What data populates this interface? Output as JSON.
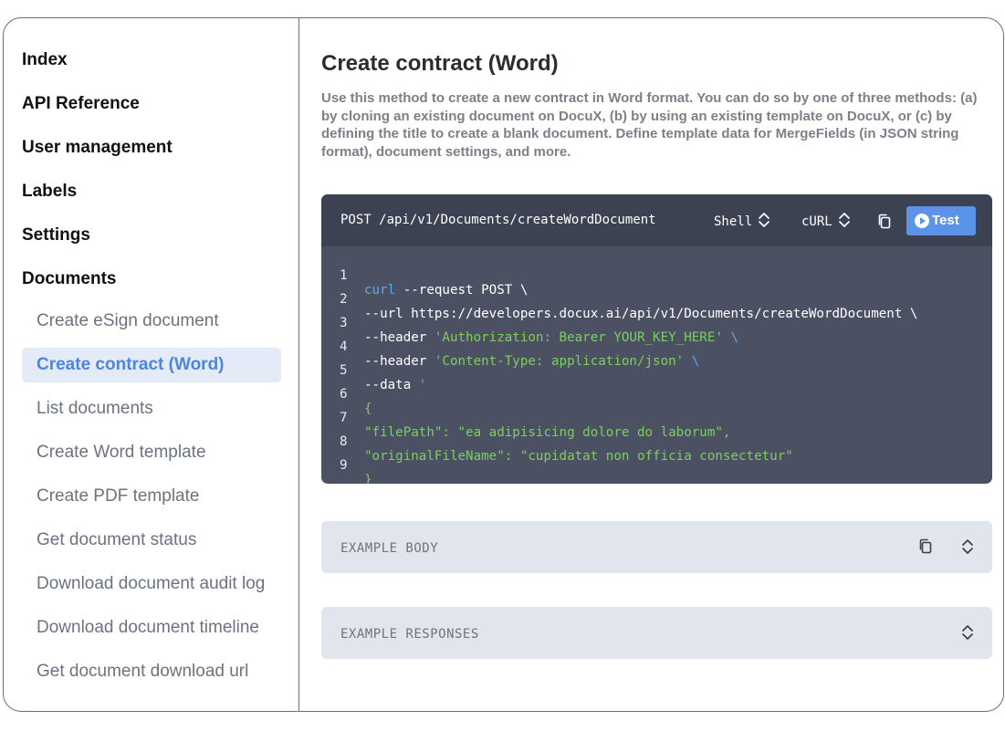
{
  "sidebar": {
    "sections": {
      "index": "Index",
      "api_reference": "API Reference",
      "user_management": "User management",
      "labels": "Labels",
      "settings": "Settings",
      "documents": "Documents"
    },
    "documents_items": [
      "Create eSign document",
      "Create contract (Word)",
      "List documents",
      "Create Word template",
      "Create PDF template",
      "Get document status",
      "Download document audit log",
      "Download document timeline",
      "Get document download url"
    ],
    "active_item": "Create contract (Word)"
  },
  "main": {
    "title": "Create contract (Word)",
    "description": "Use this method to create a new contract in Word format. You can do so by one of three methods: (a) by cloning an existing document on DocuX, (b) by using an existing template on DocuX, or (c) by defining the title to create a blank document. Define template data for MergeFields (in JSON string format), document settings, and more."
  },
  "code": {
    "endpoint": "POST /api/v1/Documents/createWordDocument",
    "language_select": "Shell",
    "client_select": "cURL",
    "test_label": "Test",
    "line_numbers": [
      "1",
      "2",
      "3",
      "4",
      "5",
      "6",
      "7",
      "8",
      "9"
    ],
    "lines": [
      {
        "a": "curl",
        "b": " --request POST \\"
      },
      {
        "a": "--url https://developers.docux.ai/api/v1/Documents/createWordDocument \\"
      },
      {
        "a": "--header ",
        "b": "'Authorization: Bearer YOUR_KEY_HERE'",
        "c": " \\"
      },
      {
        "a": "--header ",
        "b": "'Content-Type: application/json'",
        "c": " \\"
      },
      {
        "a": "--data ",
        "b": "'"
      },
      {
        "a": "{"
      },
      {
        "a": "\"filePath\": \"ea adipisicing dolore do laborum\","
      },
      {
        "a": "\"originalFileName\": \"cupidatat non officia consectetur\""
      },
      {
        "a": "}"
      }
    ]
  },
  "accordions": {
    "example_body": "EXAMPLE BODY",
    "example_responses": "EXAMPLE RESPONSES"
  },
  "colors": {
    "accent": "#5b93e8",
    "active_bg": "#e3eaf8",
    "code_bg": "#4b5163",
    "code_header_bg": "#3d4252",
    "code_green": "#7ccf5c",
    "code_blue": "#5aaaf0"
  }
}
